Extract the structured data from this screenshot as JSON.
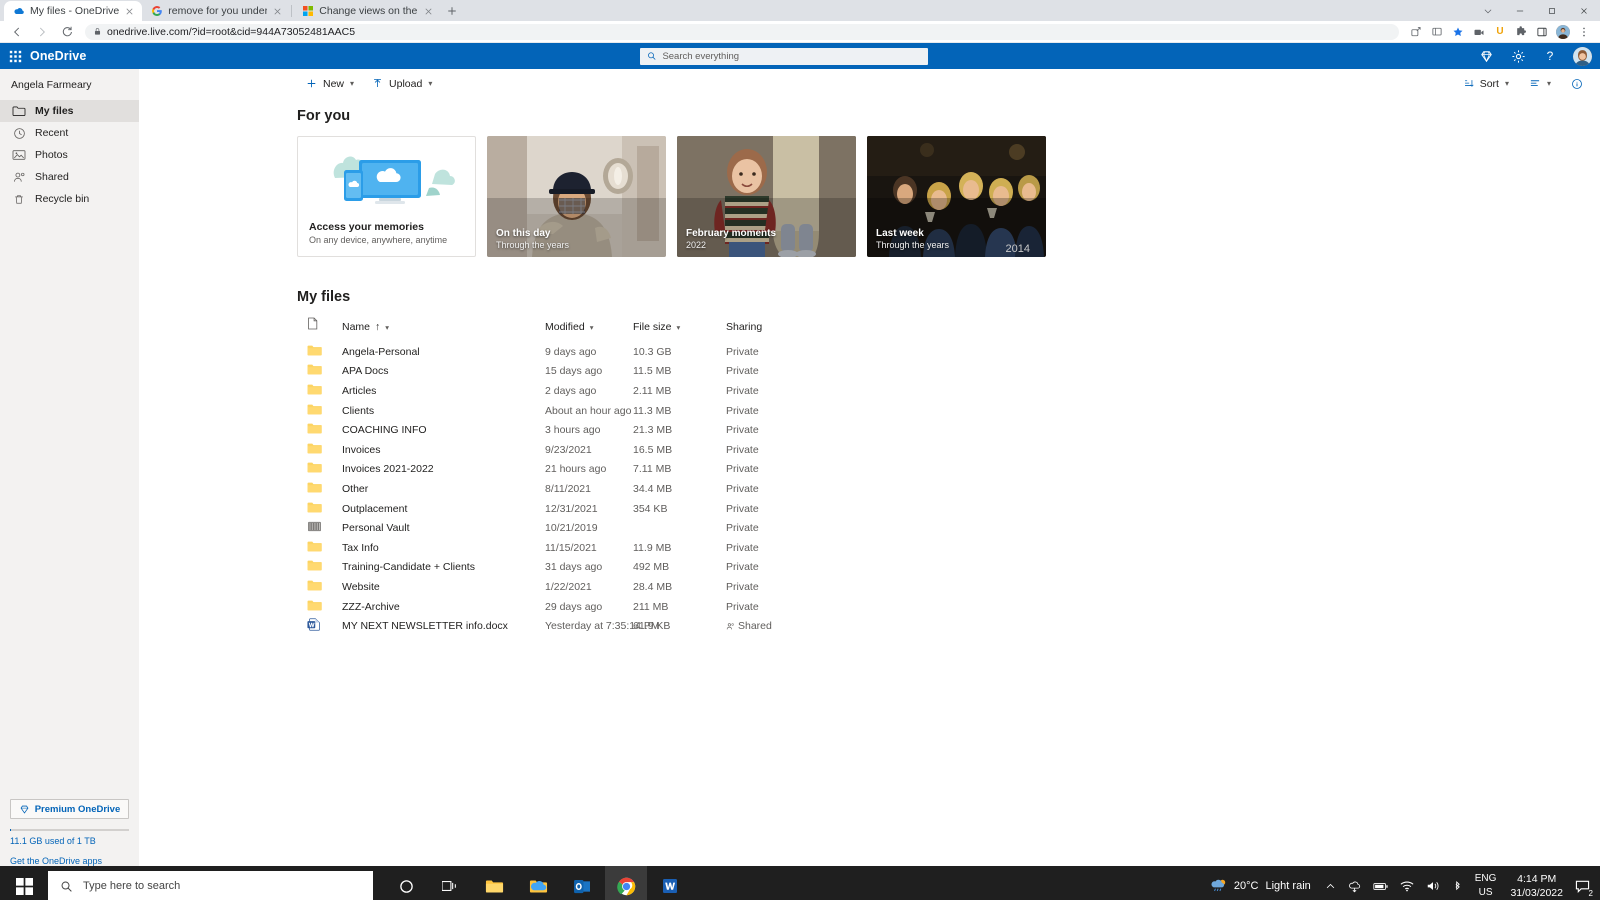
{
  "browser": {
    "tabs": [
      {
        "title": "My files - OneDrive",
        "favicon": "onedrive-icon",
        "active": true
      },
      {
        "title": "remove for you under files in on",
        "favicon": "google-icon",
        "active": false
      },
      {
        "title": "Change views on the OneDrive w",
        "favicon": "microsoft-icon",
        "active": false
      }
    ],
    "new_tab_label": "+",
    "url": "onedrive.live.com/?id=root&cid=944A73052481AAC5",
    "nav": {
      "back": "back-icon",
      "forward": "forward-icon",
      "reload": "reload-icon"
    },
    "extensions": [
      "share-icon",
      "collections-icon",
      "bookmark-star-icon",
      "extension-camera-icon",
      "extension-u-icon",
      "extension-puzzle-icon",
      "sidebar-icon"
    ],
    "window_controls": [
      "chevron-down-icon",
      "minimize-icon",
      "maximize-icon",
      "close-icon"
    ]
  },
  "suite": {
    "waffle_label": "app-launcher",
    "brand": "OneDrive",
    "search": {
      "placeholder": "Search everything",
      "value": ""
    },
    "right_icons": [
      "diamond-premium-icon",
      "settings-gear-icon",
      "help-question-icon",
      "account-avatar"
    ]
  },
  "sidebar": {
    "account_name": "Angela Farmeary",
    "items": [
      {
        "label": "My files",
        "icon": "folder-icon",
        "selected": true
      },
      {
        "label": "Recent",
        "icon": "clock-icon",
        "selected": false
      },
      {
        "label": "Photos",
        "icon": "photo-icon",
        "selected": false
      },
      {
        "label": "Shared",
        "icon": "people-shared-icon",
        "selected": false
      },
      {
        "label": "Recycle bin",
        "icon": "trash-icon",
        "selected": false
      }
    ],
    "premium_button": "Premium OneDrive",
    "premium_icon": "diamond-icon",
    "storage_text": "11.1 GB used of 1 TB",
    "storage_percent": 1.1,
    "get_apps_link": "Get the OneDrive apps"
  },
  "commandbar": {
    "new_label": "New",
    "upload_label": "Upload",
    "sort_label": "Sort",
    "new_icon": "plus-icon",
    "upload_icon": "upload-arrow-icon",
    "sort_icon": "sort-lines-icon",
    "view_icon": "view-list-icon",
    "info_icon": "info-circle-icon"
  },
  "for_you": {
    "title": "For you",
    "cards": [
      {
        "kind": "promo",
        "title": "Access your memories",
        "subtitle": "On any device, anywhere, anytime",
        "art": "devices-cloud-illustration"
      },
      {
        "kind": "photo",
        "title": "On this day",
        "subtitle": "Through the years",
        "year": ""
      },
      {
        "kind": "photo",
        "title": "February moments",
        "subtitle": "2022",
        "year": ""
      },
      {
        "kind": "photo",
        "title": "Last week",
        "subtitle": "Through the years",
        "year": "2014"
      }
    ]
  },
  "my_files": {
    "title": "My files",
    "columns": {
      "icon": "file-type-icon",
      "name": "Name",
      "name_sort_arrow": "↑",
      "modified": "Modified",
      "file_size": "File size",
      "sharing": "Sharing"
    },
    "rows": [
      {
        "icon": "folder-icon",
        "name": "Angela-Personal",
        "modified": "9 days ago",
        "size": "10.3 GB",
        "sharing": "Private",
        "shared": false
      },
      {
        "icon": "folder-icon",
        "name": "APA Docs",
        "modified": "15 days ago",
        "size": "11.5 MB",
        "sharing": "Private",
        "shared": false
      },
      {
        "icon": "folder-icon",
        "name": "Articles",
        "modified": "2 days ago",
        "size": "2.11 MB",
        "sharing": "Private",
        "shared": false
      },
      {
        "icon": "folder-icon",
        "name": "Clients",
        "modified": "About an hour ago",
        "size": "11.3 MB",
        "sharing": "Private",
        "shared": false
      },
      {
        "icon": "folder-icon",
        "name": "COACHING INFO",
        "modified": "3 hours ago",
        "size": "21.3 MB",
        "sharing": "Private",
        "shared": false
      },
      {
        "icon": "folder-icon",
        "name": "Invoices",
        "modified": "9/23/2021",
        "size": "16.5 MB",
        "sharing": "Private",
        "shared": false
      },
      {
        "icon": "folder-icon",
        "name": "Invoices 2021-2022",
        "modified": "21 hours ago",
        "size": "7.11 MB",
        "sharing": "Private",
        "shared": false
      },
      {
        "icon": "folder-icon",
        "name": "Other",
        "modified": "8/11/2021",
        "size": "34.4 MB",
        "sharing": "Private",
        "shared": false
      },
      {
        "icon": "folder-icon",
        "name": "Outplacement",
        "modified": "12/31/2021",
        "size": "354 KB",
        "sharing": "Private",
        "shared": false
      },
      {
        "icon": "vault-icon",
        "name": "Personal Vault",
        "modified": "10/21/2019",
        "size": "",
        "sharing": "Private",
        "shared": false
      },
      {
        "icon": "folder-icon",
        "name": "Tax Info",
        "modified": "11/15/2021",
        "size": "11.9 MB",
        "sharing": "Private",
        "shared": false
      },
      {
        "icon": "folder-icon",
        "name": "Training-Candidate + Clients",
        "modified": "31 days ago",
        "size": "492 MB",
        "sharing": "Private",
        "shared": false
      },
      {
        "icon": "folder-icon",
        "name": "Website",
        "modified": "1/22/2021",
        "size": "28.4 MB",
        "sharing": "Private",
        "shared": false
      },
      {
        "icon": "folder-icon",
        "name": "ZZZ-Archive",
        "modified": "29 days ago",
        "size": "211 MB",
        "sharing": "Private",
        "shared": false
      },
      {
        "icon": "word-doc-icon",
        "name": "MY NEXT NEWSLETTER info.docx",
        "modified": "Yesterday at 7:35:14 PM",
        "size": "61.9 KB",
        "sharing": "Shared",
        "shared": true
      }
    ]
  },
  "taskbar": {
    "start_icon": "windows-start-icon",
    "search_placeholder": "Type here to search",
    "search_icon": "search-icon",
    "apps": [
      {
        "name": "cortana-icon",
        "running": false,
        "active": false
      },
      {
        "name": "task-view-icon",
        "running": false,
        "active": false
      },
      {
        "name": "file-explorer-icon",
        "running": true,
        "active": false
      },
      {
        "name": "onedrive-taskbar-icon",
        "running": true,
        "active": false
      },
      {
        "name": "outlook-icon",
        "running": true,
        "active": false
      },
      {
        "name": "chrome-icon",
        "running": true,
        "active": true
      },
      {
        "name": "word-icon",
        "running": true,
        "active": false
      }
    ],
    "weather_temp": "20°C",
    "weather_desc": "Light rain",
    "weather_icon": "rain-cloud-icon",
    "tray_icons": [
      "chevron-up-icon",
      "onedrive-sync-icon",
      "battery-icon",
      "wifi-icon",
      "volume-icon",
      "bluetooth-icon"
    ],
    "language": "ENG",
    "region": "US",
    "time": "4:14 PM",
    "date": "31/03/2022",
    "notification_icon": "notification-icon",
    "notification_count": "2"
  },
  "colors": {
    "onedrive_blue": "#0364b8",
    "folder_yellow": "#fcd462",
    "sidebar_bg": "#f3f2f1",
    "taskbar_bg": "#1f1f1f"
  }
}
